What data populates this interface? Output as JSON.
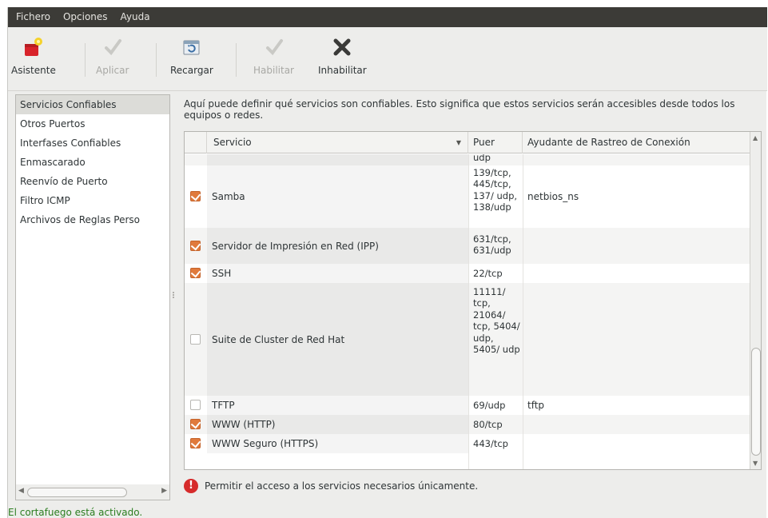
{
  "menubar": [
    "Fichero",
    "Opciones",
    "Ayuda"
  ],
  "toolbar": {
    "wizard": "Asistente",
    "apply": "Aplicar",
    "reload": "Recargar",
    "enable": "Habilitar",
    "disable": "Inhabilitar"
  },
  "sidebar": {
    "items": [
      {
        "label": "Servicios Confiables",
        "selected": true
      },
      {
        "label": "Otros Puertos"
      },
      {
        "label": "Interfases Confiables"
      },
      {
        "label": "Enmascarado"
      },
      {
        "label": "Reenvío de Puerto"
      },
      {
        "label": "Filtro ICMP"
      },
      {
        "label": "Archivos de Reglas Perso"
      }
    ]
  },
  "description": "Aquí puede definir qué servicios son confiables. Esto significa que estos servicios serán accesibles desde todos los equipos o redes.",
  "table": {
    "columns": [
      "Servicio",
      "Puer",
      "Ayudante de Rastreo de Conexión"
    ],
    "rows": [
      {
        "checked": null,
        "name": "",
        "ports": "udp",
        "helper": ""
      },
      {
        "checked": true,
        "name": "Samba",
        "ports": "139/tcp, 445/tcp, 137/ udp, 138/udp",
        "helper": "netbios_ns"
      },
      {
        "checked": true,
        "name": "Servidor de Impresión en Red (IPP)",
        "ports": "631/tcp, 631/udp",
        "helper": ""
      },
      {
        "checked": true,
        "name": "SSH",
        "ports": "22/tcp",
        "helper": ""
      },
      {
        "checked": false,
        "name": "Suite de Cluster de Red Hat",
        "ports": "11111/ tcp, 21064/ tcp, 5404/ udp, 5405/ udp",
        "helper": ""
      },
      {
        "checked": false,
        "name": "TFTP",
        "ports": "69/udp",
        "helper": "tftp"
      },
      {
        "checked": true,
        "name": "WWW (HTTP)",
        "ports": "80/tcp",
        "helper": ""
      },
      {
        "checked": true,
        "name": "WWW Seguro (HTTPS)",
        "ports": "443/tcp",
        "helper": ""
      }
    ]
  },
  "notice": "Permitir el acceso a los servicios necesarios únicamente.",
  "status": "El cortafuego está activado.",
  "colors": {
    "check": "#e07a3c",
    "status_text": "#2a7d1f",
    "menubar": "#3c3b37",
    "warning": "#d62b2b"
  }
}
